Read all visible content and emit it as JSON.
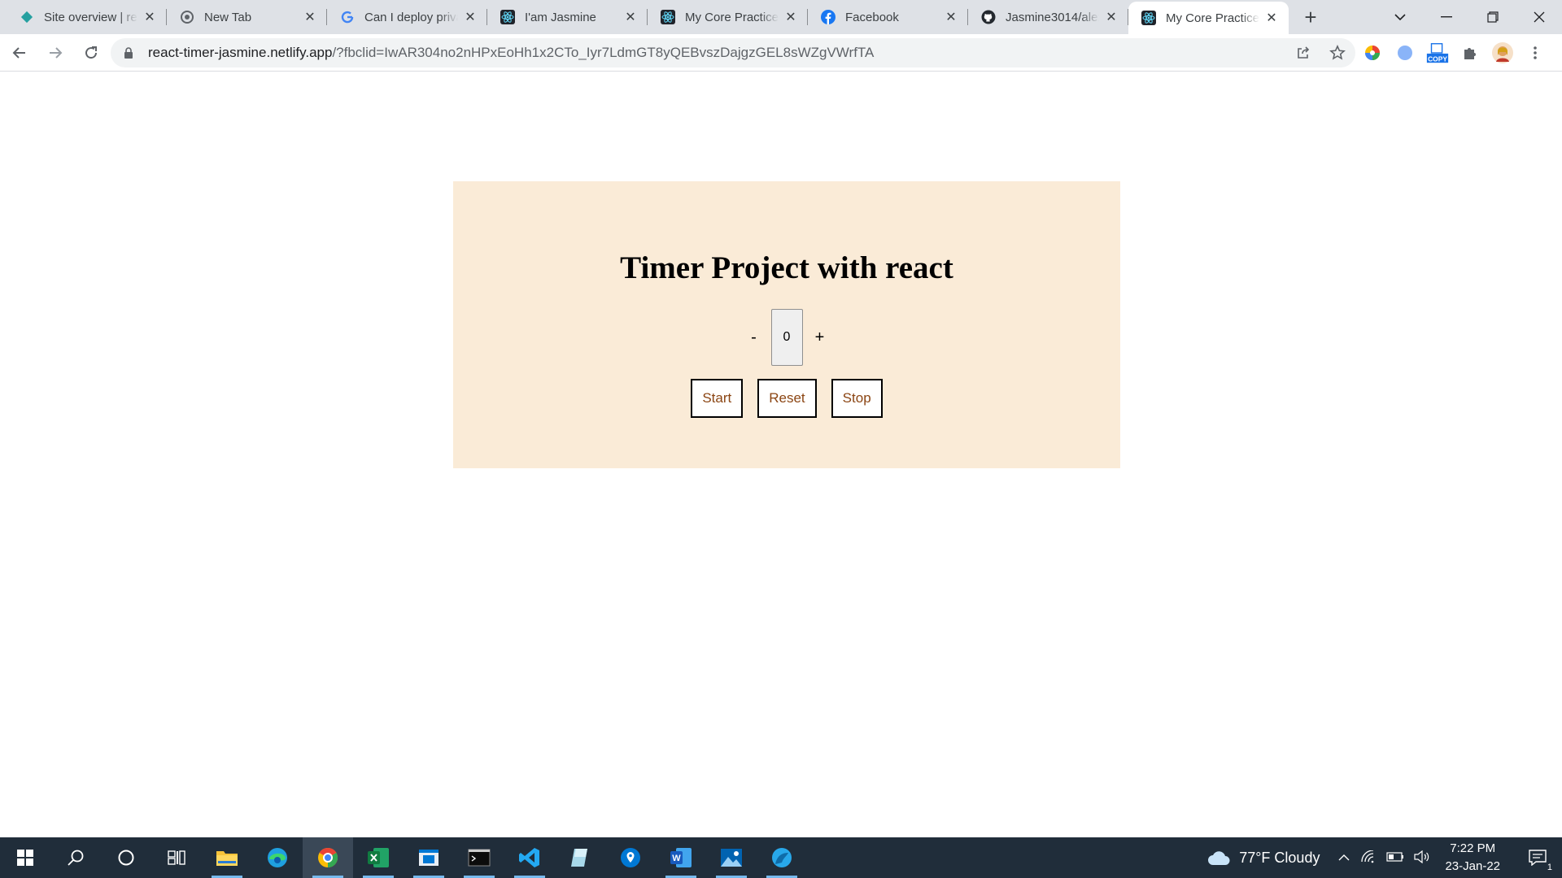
{
  "browser": {
    "tabs": [
      {
        "title": "Site overview | react-timer-jasmine",
        "icon": "netlify-icon",
        "active": false
      },
      {
        "title": "New Tab",
        "icon": "chrome-icon",
        "active": false
      },
      {
        "title": "Can I deploy private repo",
        "icon": "google-icon",
        "active": false
      },
      {
        "title": "I'am Jasmine",
        "icon": "react-icon",
        "active": false
      },
      {
        "title": "My Core Practice",
        "icon": "react-icon",
        "active": false
      },
      {
        "title": "Facebook",
        "icon": "facebook-icon",
        "active": false
      },
      {
        "title": "Jasmine3014/alex",
        "icon": "github-icon",
        "active": false
      },
      {
        "title": "My Core Practice",
        "icon": "react-icon",
        "active": true
      }
    ],
    "url_host": "react-timer-jasmine.netlify.app",
    "url_rest": "/?fbclid=IwAR304no2nHPxEoHh1x2CTo_Iyr7LdmGT8yQEBvszDajgzGEL8sWZgVWrfTA",
    "extension_copy_label": "COPY"
  },
  "page": {
    "heading": "Timer Project with react",
    "decrement_label": "-",
    "counter_value": "0",
    "increment_label": "+",
    "start_label": "Start",
    "reset_label": "Reset",
    "stop_label": "Stop",
    "card_color": "#faebd7",
    "button_text_color": "#8b4513"
  },
  "taskbar": {
    "weather": "77°F  Cloudy",
    "time": "7:22 PM",
    "date": "23-Jan-22",
    "notification_count": "1"
  }
}
